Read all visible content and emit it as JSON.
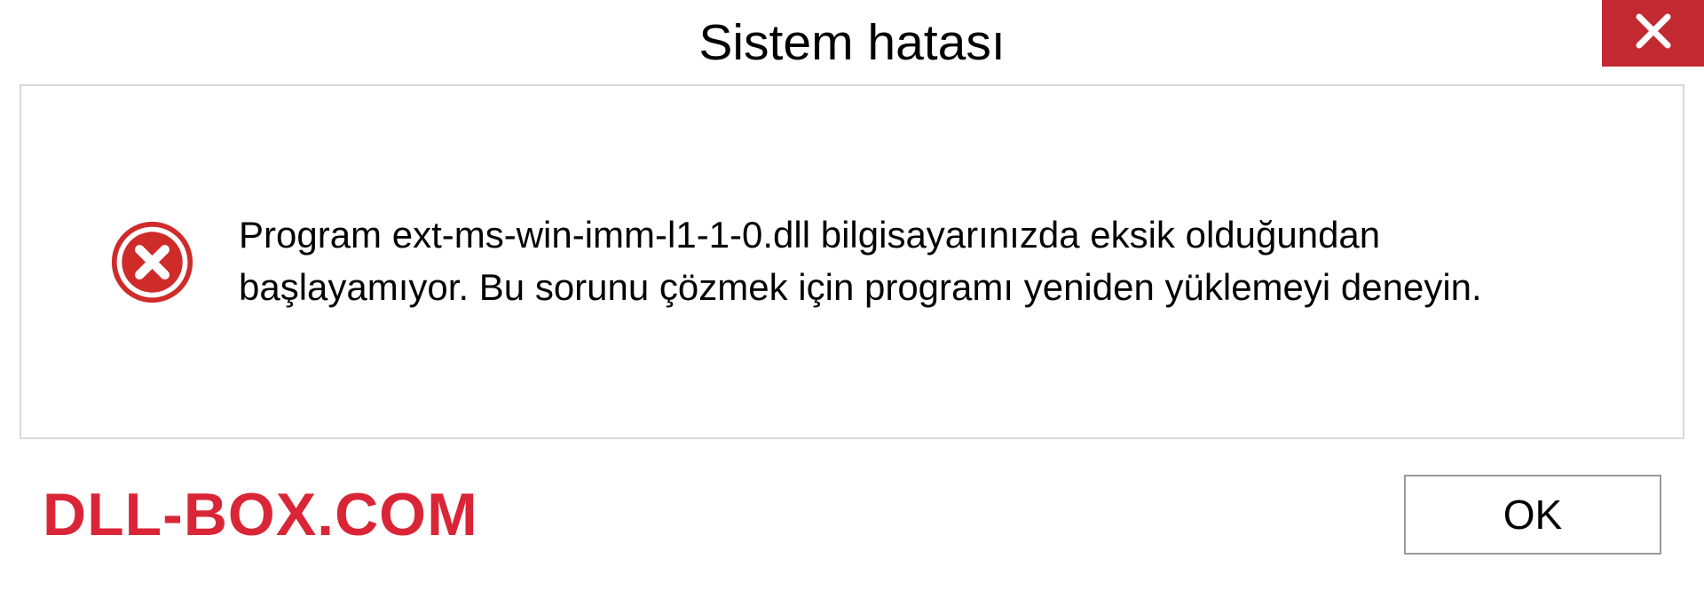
{
  "dialog": {
    "title": "Sistem hatası",
    "message": "Program ext-ms-win-imm-l1-1-0.dll bilgisayarınızda eksik olduğundan başlayamıyor. Bu sorunu çözmek için programı yeniden yüklemeyi deneyin.",
    "ok_label": "OK"
  },
  "watermark": "DLL-BOX.COM",
  "colors": {
    "close_bg": "#c22930",
    "watermark": "#da2536",
    "border": "#d8d8d8"
  }
}
